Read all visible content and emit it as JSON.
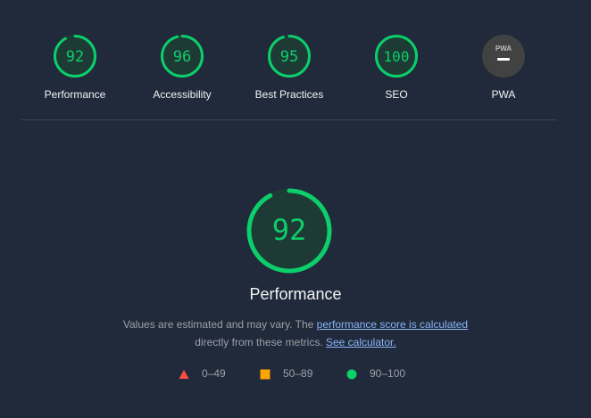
{
  "categories": [
    {
      "label": "Performance",
      "score": "92",
      "value": 0.92
    },
    {
      "label": "Accessibility",
      "score": "96",
      "value": 0.96
    },
    {
      "label": "Best Practices",
      "score": "95",
      "value": 0.95
    },
    {
      "label": "SEO",
      "score": "100",
      "value": 1.0
    },
    {
      "label": "PWA",
      "icon_text": "PWA"
    }
  ],
  "main": {
    "score": "92",
    "value": 0.92,
    "title": "Performance",
    "desc_prefix": "Values are estimated and may vary. The ",
    "desc_link": "performance score is calculated",
    "desc_mid": "directly from these metrics. ",
    "desc_link2": "See calculator."
  },
  "legend": [
    {
      "label": "0–49",
      "color": "#ff4e42",
      "shape": "triangle"
    },
    {
      "label": "50–89",
      "color": "#ffa400",
      "shape": "square"
    },
    {
      "label": "90–100",
      "color": "#0cce6b",
      "shape": "circle"
    }
  ],
  "colors": {
    "pass": "#0cce6b",
    "pass_bg": "#1e3a35",
    "pwa_bg": "#424242"
  }
}
